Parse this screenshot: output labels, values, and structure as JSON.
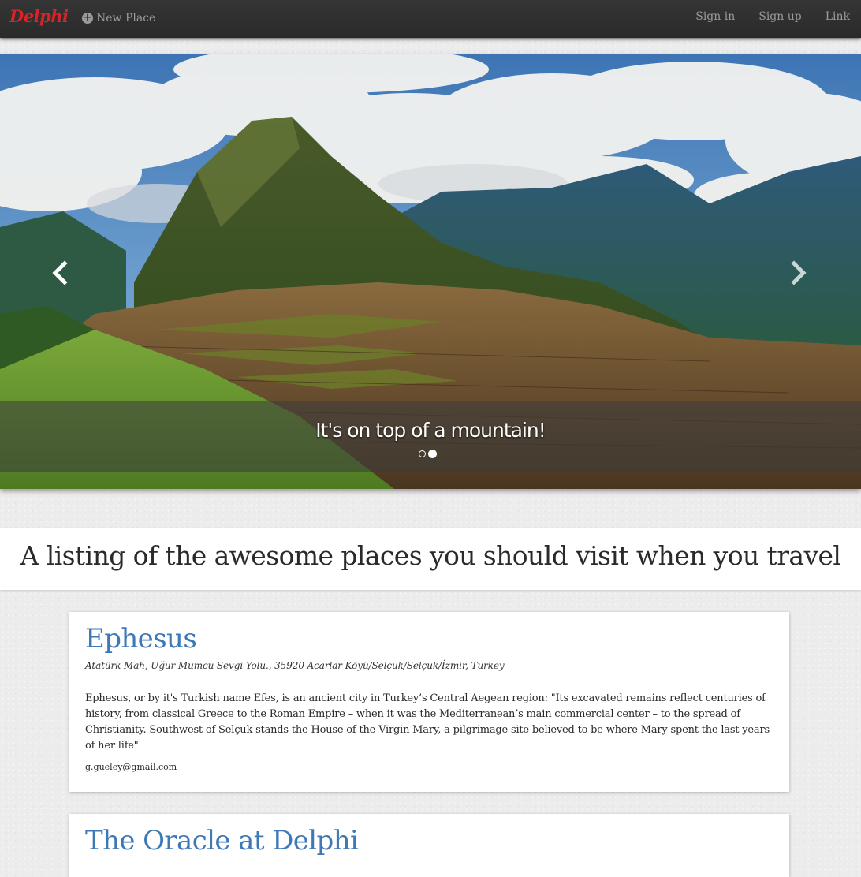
{
  "navbar": {
    "brand": "Delphi",
    "new_place": "New Place",
    "links": [
      "Sign in",
      "Sign up",
      "Link"
    ]
  },
  "carousel": {
    "caption": "It's on top of a mountain!",
    "slide_count": 2,
    "active_slide": 2
  },
  "tagline": "A listing of the awesome places you should visit when you travel",
  "places": [
    {
      "name": "Ephesus",
      "address": "Atatürk Mah, Uğur Mumcu Sevgi Yolu., 35920 Acarlar Köyü/Selçuk/Selçuk/İzmir, Turkey",
      "description": "Ephesus, or by it's Turkish name Efes, is an ancient city in Turkey’s Central Aegean region: \"Its excavated remains reflect centuries of history, from classical Greece to the Roman Empire – when it was the Mediterranean’s main commercial center – to the spread of Christianity. Southwest of Selçuk stands the House of the Virgin Mary, a pilgrimage site believed to be where Mary spent the last years of her life\"",
      "email": "g.gueley@gmail.com"
    },
    {
      "name": "The Oracle at Delphi"
    }
  ],
  "colors": {
    "navbar": "#2f2f2f",
    "brand": "#d8232a",
    "place_title": "#3d79b6"
  }
}
